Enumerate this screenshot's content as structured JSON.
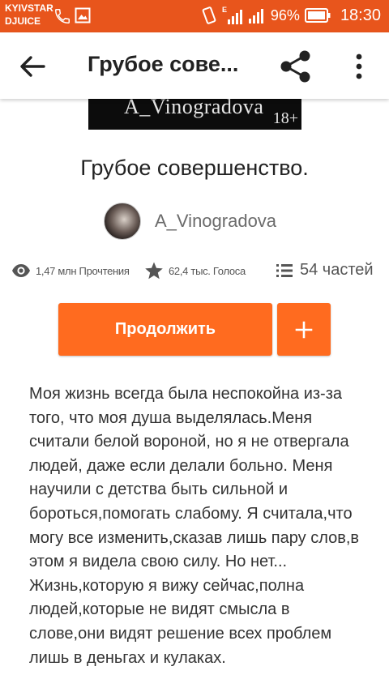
{
  "status_bar": {
    "carrier_line1": "KYIVSTAR",
    "carrier_line2": "DJUICE",
    "battery_percent": "96%",
    "time": "18:30",
    "icons": [
      "phone-icon",
      "image-icon",
      "vibrate-icon",
      "signal-e-icon",
      "signal-icon",
      "battery-icon"
    ]
  },
  "app_bar": {
    "title": "Грубое сове...",
    "icons": [
      "back-arrow-icon",
      "share-icon",
      "more-vert-icon"
    ]
  },
  "cover": {
    "author": "A_Vinogradova",
    "rating": "18+"
  },
  "story": {
    "title": "Грубое совершенство.",
    "author": "A_Vinogradova",
    "reads": "1,47 млн Прочтения",
    "votes": "62,4 тыс. Голоса",
    "parts": "54 частей",
    "description": "Моя жизнь всегда была неспокойна из-за того, что моя душа выделялась.Меня считали белой вороной, но я не отвергала людей, даже если делали больно. Меня научили с детства быть сильной и бороться,помогать слабому. Я считала,что могу все изменить,сказав лишь пару слов,в этом я видела свою силу. Но нет... Жизнь,которую я вижу сейчас,полна людей,которые не видят смысла в слове,они видят решение всех проблем лишь в деньгах и кулаках."
  },
  "actions": {
    "continue_label": "Продолжить",
    "add_icon": "plus-icon"
  },
  "colors": {
    "status_bar": "#e8551c",
    "accent": "#ff6b1f"
  }
}
